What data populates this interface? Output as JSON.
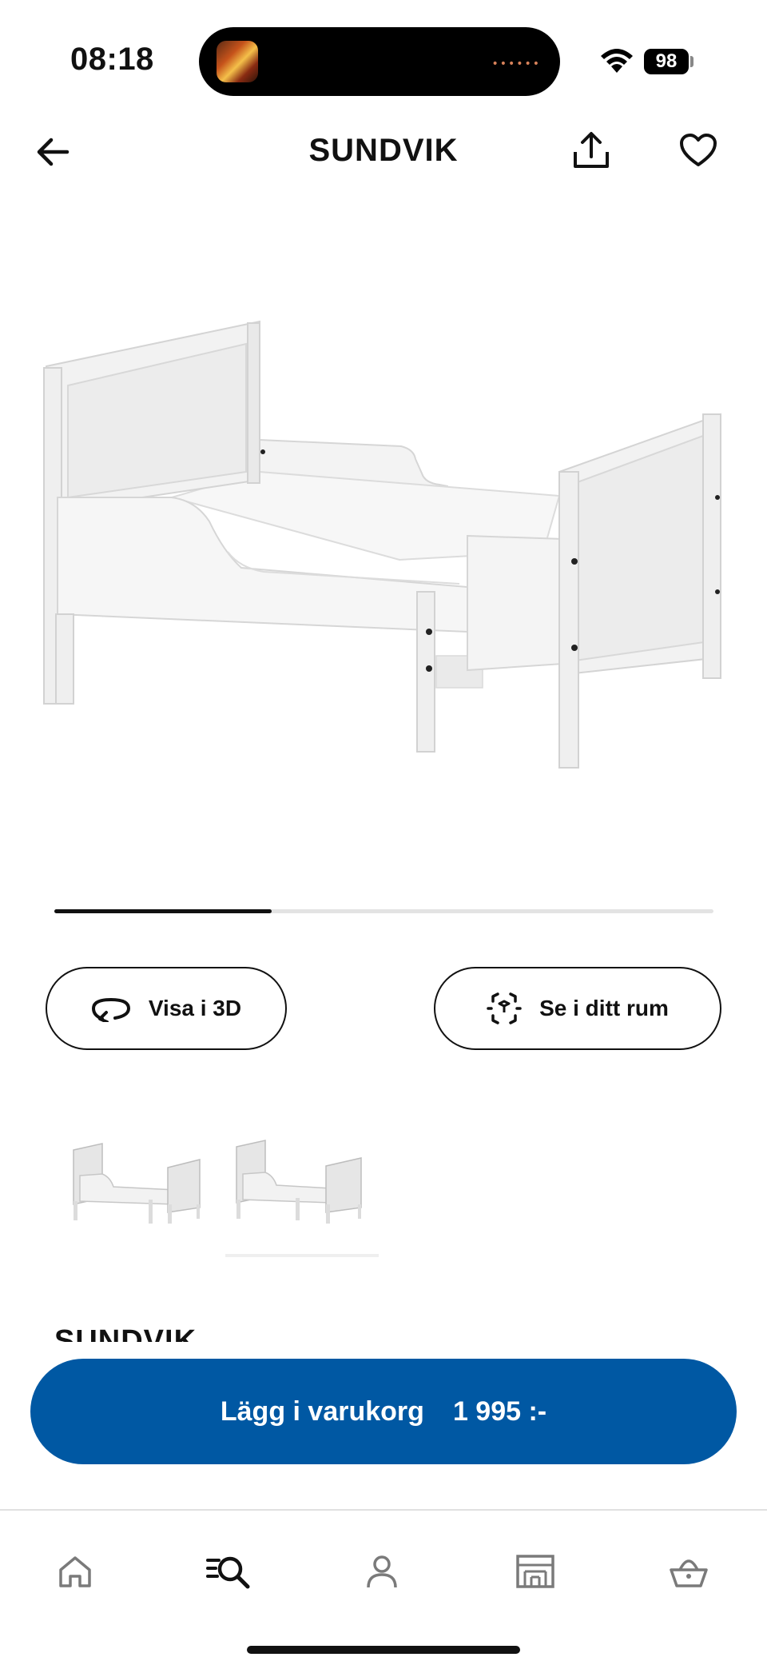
{
  "status_bar": {
    "time": "08:18",
    "battery": "98",
    "icons": [
      "wifi-icon",
      "battery-icon"
    ]
  },
  "header": {
    "title": "SUNDVIK",
    "icons": [
      "arrow-left-icon",
      "share-icon",
      "heart-icon"
    ]
  },
  "gallery": {
    "progress_fraction": 0.33,
    "thumbnails": [
      "bed-thumbnail-1",
      "bed-thumbnail-2"
    ],
    "selected_thumbnail": 2
  },
  "actions": {
    "view_3d_label": "Visa i 3D",
    "view_room_label": "Se i ditt rum"
  },
  "product": {
    "name": "SUNDVIK"
  },
  "cart": {
    "label": "Lägg i varukorg",
    "price": "1 995 :-",
    "color": "#0058a3"
  },
  "tabbar": {
    "tabs": [
      "home-icon",
      "search-icon",
      "profile-icon",
      "store-icon",
      "basket-icon"
    ],
    "active": "search-icon"
  }
}
